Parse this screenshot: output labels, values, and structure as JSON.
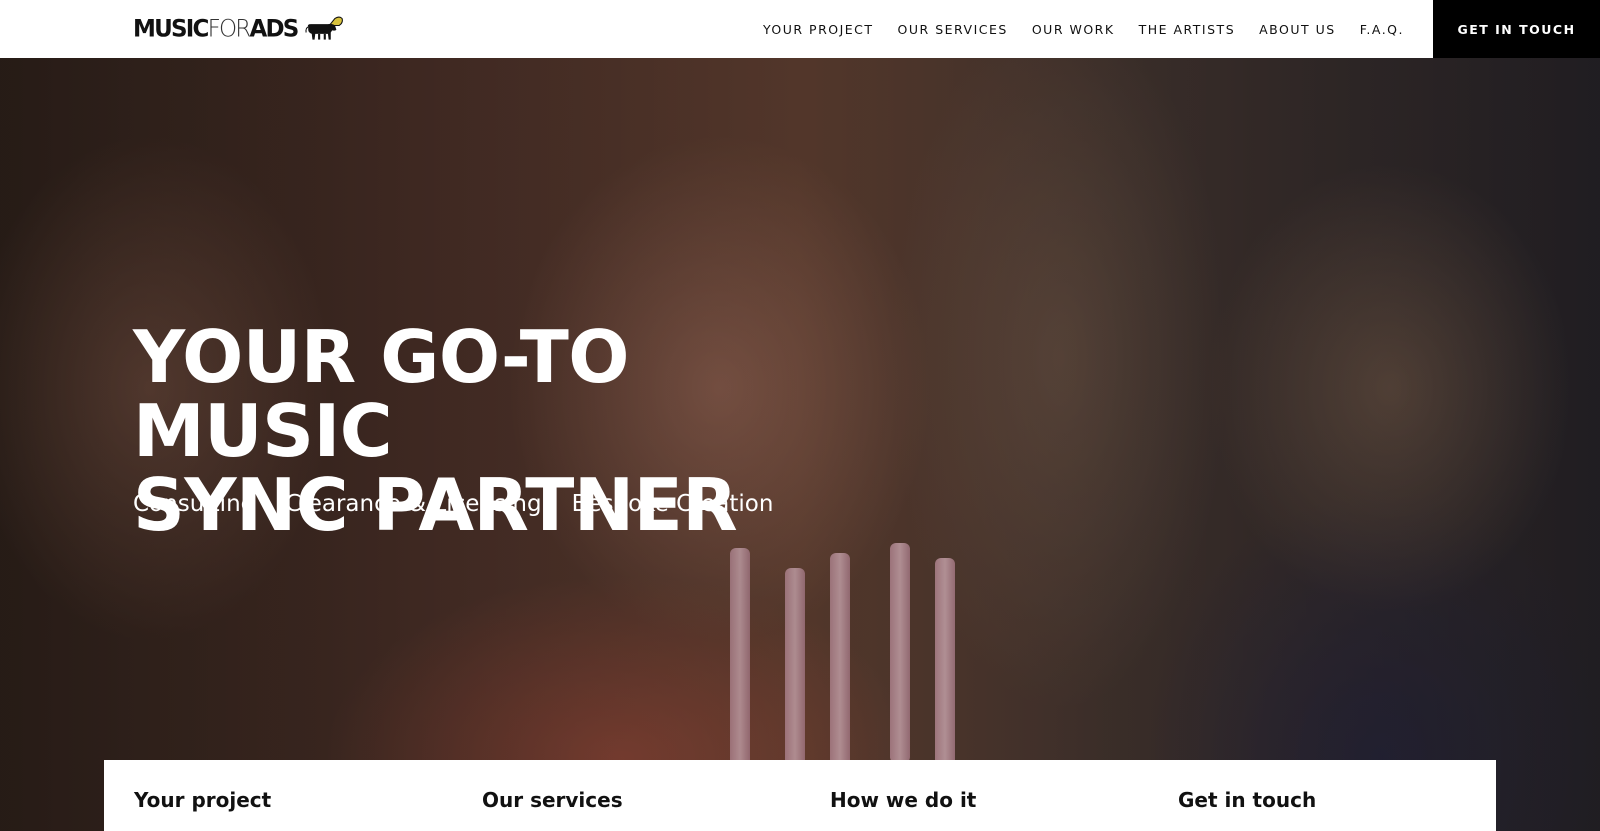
{
  "header": {
    "logo": {
      "part1": "MUSIC",
      "part2": "FOR",
      "part3": "ADS",
      "icon": "cow-with-gramophone-icon"
    },
    "nav": [
      "YOUR PROJECT",
      "OUR SERVICES",
      "OUR WORK",
      "THE ARTISTS",
      "ABOUT US",
      "F.A.Q."
    ],
    "cta": "GET IN TOUCH"
  },
  "hero": {
    "headline_line1": "YOUR GO-TO MUSIC",
    "headline_line2": "SYNC PARTNER",
    "tags": [
      "Consulting",
      "Clearance & Licensing",
      "Bespoke Creation"
    ]
  },
  "panel": {
    "columns": [
      "Your project",
      "Our services",
      "How we do it",
      "Get in touch"
    ]
  },
  "colors": {
    "header_bg": "#ffffff",
    "cta_bg": "#000000",
    "text_on_hero": "#ffffff"
  }
}
